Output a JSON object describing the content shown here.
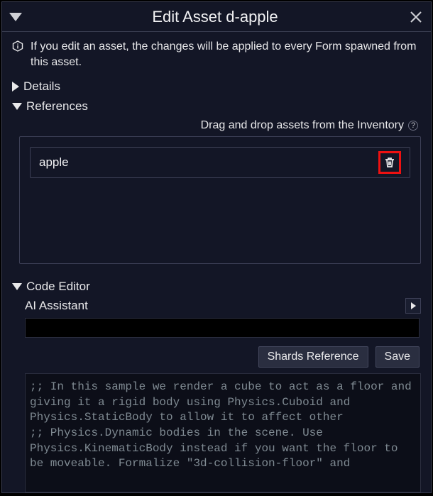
{
  "title": "Edit Asset d-apple",
  "info_text": "If you edit an asset, the changes will be applied to every Form spawned from this asset.",
  "sections": {
    "details": {
      "label": "Details",
      "expanded": false
    },
    "references": {
      "label": "References",
      "expanded": true,
      "hint": "Drag and drop assets from the Inventory",
      "items": [
        {
          "name": "apple"
        }
      ]
    },
    "code_editor": {
      "label": "Code Editor",
      "expanded": true,
      "ai_label": "AI Assistant",
      "buttons": {
        "shards_reference": "Shards Reference",
        "save": "Save"
      },
      "code": ";; In this sample we render a cube to act as a floor and giving it a rigid body using Physics.Cuboid and Physics.StaticBody to allow it to affect other\n;; Physics.Dynamic bodies in the scene. Use Physics.KinematicBody instead if you want the floor to be moveable. Formalize \"3d-collision-floor\" and"
    }
  }
}
